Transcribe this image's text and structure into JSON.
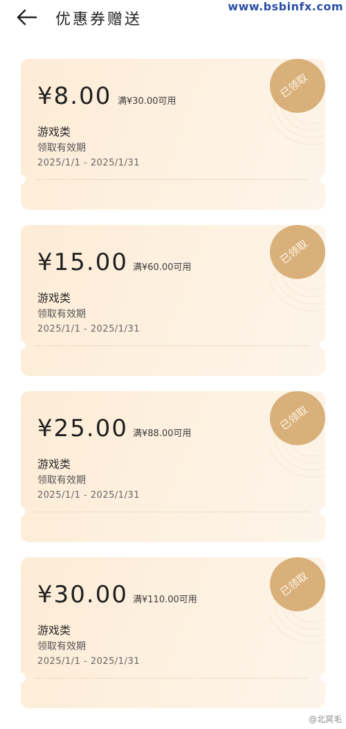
{
  "header": {
    "title": "优惠券赠送",
    "back_icon": "arrow-left-icon"
  },
  "watermark": "www.bsbinfx.com",
  "coupons": [
    {
      "amount": "¥8.00",
      "condition": "满¥30.00可用",
      "category": "游戏类",
      "validity_label": "领取有效期",
      "validity_range": "2025/1/1 - 2025/1/31",
      "status": "已领取"
    },
    {
      "amount": "¥15.00",
      "condition": "满¥60.00可用",
      "category": "游戏类",
      "validity_label": "领取有效期",
      "validity_range": "2025/1/1 - 2025/1/31",
      "status": "已领取"
    },
    {
      "amount": "¥25.00",
      "condition": "满¥88.00可用",
      "category": "游戏类",
      "validity_label": "领取有效期",
      "validity_range": "2025/1/1 - 2025/1/31",
      "status": "已领取"
    },
    {
      "amount": "¥30.00",
      "condition": "满¥110.00可用",
      "category": "游戏类",
      "validity_label": "领取有效期",
      "validity_range": "2025/1/1 - 2025/1/31",
      "status": "已领取"
    }
  ],
  "footer": {
    "source_mark": "@北冥毛"
  },
  "colors": {
    "card_bg": "#fdecd6",
    "stamp": "#d9b07a",
    "watermark": "#2a4ea8"
  }
}
